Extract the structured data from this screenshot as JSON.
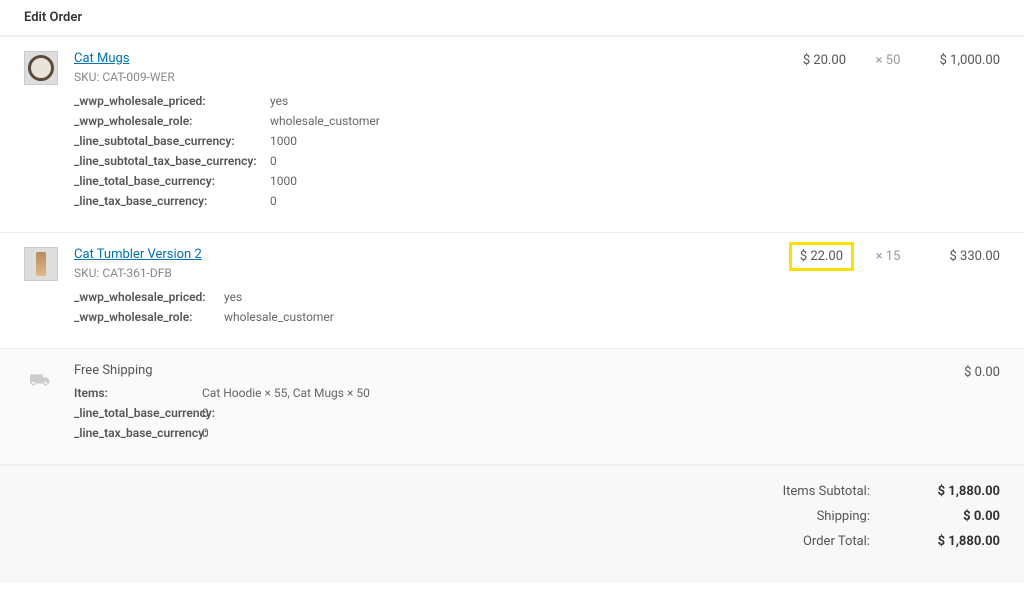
{
  "header": {
    "title": "Edit Order"
  },
  "items": [
    {
      "name": "Cat Mugs",
      "sku_label": "SKU:",
      "sku": "CAT-009-WER",
      "meta": [
        {
          "key": "_wwp_wholesale_priced:",
          "val": "yes"
        },
        {
          "key": "_wwp_wholesale_role:",
          "val": "wholesale_customer"
        },
        {
          "key": "_line_subtotal_base_currency:",
          "val": "1000"
        },
        {
          "key": "_line_subtotal_tax_base_currency:",
          "val": "0"
        },
        {
          "key": "_line_total_base_currency:",
          "val": "1000"
        },
        {
          "key": "_line_tax_base_currency:",
          "val": "0"
        }
      ],
      "price": "$ 20.00",
      "qty_prefix": "×",
      "qty": "50",
      "total": "$ 1,000.00"
    },
    {
      "name": "Cat Tumbler Version 2",
      "sku_label": "SKU:",
      "sku": "CAT-361-DFB",
      "meta": [
        {
          "key": "_wwp_wholesale_priced:",
          "val": "yes"
        },
        {
          "key": "_wwp_wholesale_role:",
          "val": "wholesale_customer"
        }
      ],
      "price": "$ 22.00",
      "qty_prefix": "×",
      "qty": "15",
      "total": "$ 330.00"
    }
  ],
  "shipping": {
    "title": "Free Shipping",
    "items_label": "Items:",
    "items_text": "Cat Hoodie × 55, Cat Mugs × 50",
    "meta": [
      {
        "key": "_line_total_base_currency:",
        "val": "0"
      },
      {
        "key": "_line_tax_base_currency:",
        "val": "0"
      }
    ],
    "total": "$ 0.00"
  },
  "totals": {
    "subtotal_label": "Items Subtotal:",
    "subtotal": "$ 1,880.00",
    "shipping_label": "Shipping:",
    "shipping": "$ 0.00",
    "order_total_label": "Order Total:",
    "order_total": "$ 1,880.00"
  }
}
